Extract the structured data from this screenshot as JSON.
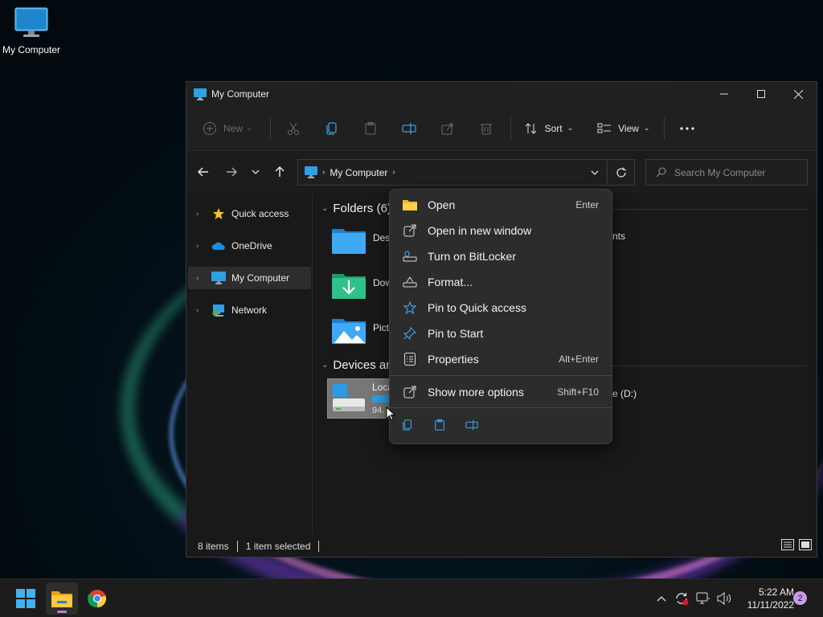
{
  "desktop": {
    "icon_label": "My Computer"
  },
  "window": {
    "title": "My Computer",
    "toolbar": {
      "new_label": "New",
      "sort_label": "Sort",
      "view_label": "View"
    },
    "address": {
      "crumb": "My Computer"
    },
    "search": {
      "placeholder": "Search My Computer"
    },
    "sidebar": {
      "items": [
        {
          "label": "Quick access"
        },
        {
          "label": "OneDrive"
        },
        {
          "label": "My Computer"
        },
        {
          "label": "Network"
        }
      ]
    },
    "content": {
      "folders_header": "Folders (6)",
      "folders": [
        {
          "name": "Desk"
        },
        {
          "name": "Dow"
        },
        {
          "name": "Pict"
        }
      ],
      "documents_tail": "nts",
      "devices_header": "Devices an",
      "drive_c": {
        "name": "Loca",
        "size": "94."
      },
      "drive_d_tail": "e (D:)"
    },
    "status": {
      "items": "8 items",
      "selected": "1 item selected"
    }
  },
  "context_menu": {
    "items": [
      {
        "label": "Open",
        "shortcut": "Enter"
      },
      {
        "label": "Open in new window",
        "shortcut": ""
      },
      {
        "label": "Turn on BitLocker",
        "shortcut": ""
      },
      {
        "label": "Format...",
        "shortcut": ""
      },
      {
        "label": "Pin to Quick access",
        "shortcut": ""
      },
      {
        "label": "Pin to Start",
        "shortcut": ""
      },
      {
        "label": "Properties",
        "shortcut": "Alt+Enter"
      },
      {
        "label": "Show more options",
        "shortcut": "Shift+F10"
      }
    ]
  },
  "taskbar": {
    "time": "5:22 AM",
    "date": "11/11/2022",
    "notification_count": "2"
  }
}
